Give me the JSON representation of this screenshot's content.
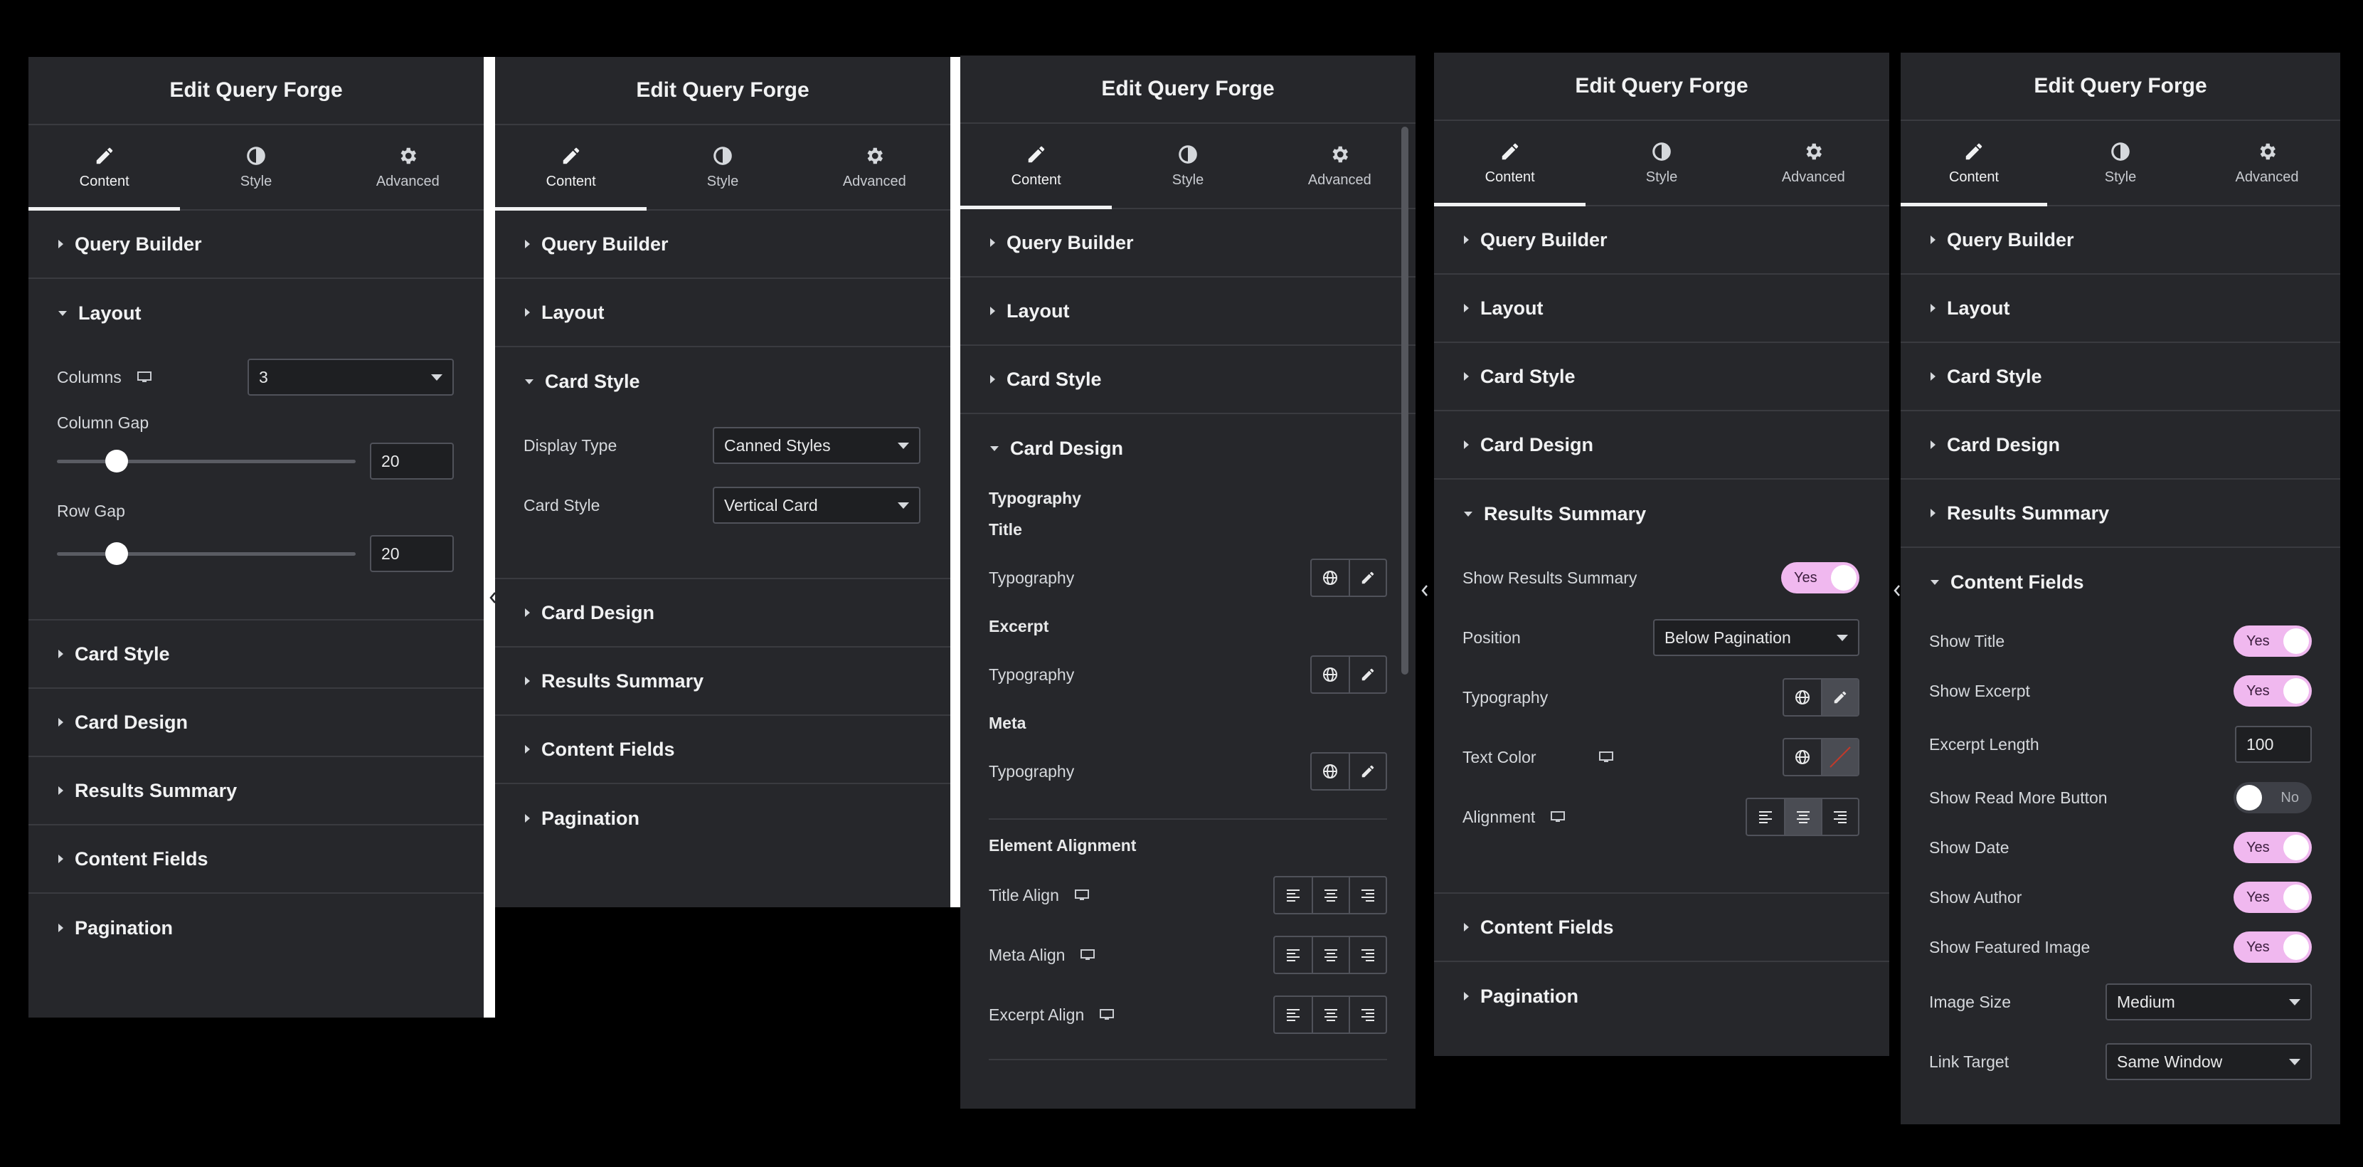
{
  "panel_title": "Edit Query Forge",
  "tabs": {
    "content": "Content",
    "style": "Style",
    "advanced": "Advanced"
  },
  "sections": {
    "query_builder": "Query Builder",
    "layout": "Layout",
    "card_style": "Card Style",
    "card_design": "Card Design",
    "results_summary": "Results Summary",
    "content_fields": "Content Fields",
    "pagination": "Pagination"
  },
  "layout_fields": {
    "columns_label": "Columns",
    "columns_value": "3",
    "column_gap_label": "Column Gap",
    "column_gap_value": "20",
    "column_gap_fraction": 0.2,
    "row_gap_label": "Row Gap",
    "row_gap_value": "20",
    "row_gap_fraction": 0.2
  },
  "card_style_fields": {
    "display_type_label": "Display Type",
    "display_type_value": "Canned Styles",
    "card_style_label": "Card Style",
    "card_style_value": "Vertical Card"
  },
  "card_design_fields": {
    "typography_heading": "Typography",
    "title_heading": "Title",
    "excerpt_heading": "Excerpt",
    "meta_heading": "Meta",
    "typography_label": "Typography",
    "element_alignment_heading": "Element Alignment",
    "title_align_label": "Title Align",
    "meta_align_label": "Meta Align",
    "excerpt_align_label": "Excerpt Align"
  },
  "results_summary_fields": {
    "show_label": "Show Results Summary",
    "show_value": "Yes",
    "position_label": "Position",
    "position_value": "Below Pagination",
    "typography_label": "Typography",
    "text_color_label": "Text Color",
    "alignment_label": "Alignment"
  },
  "content_fields": {
    "show_title_label": "Show Title",
    "show_title_value": "Yes",
    "show_excerpt_label": "Show Excerpt",
    "show_excerpt_value": "Yes",
    "excerpt_length_label": "Excerpt Length",
    "excerpt_length_value": "100",
    "show_read_more_label": "Show Read More Button",
    "show_read_more_value": "No",
    "show_date_label": "Show Date",
    "show_date_value": "Yes",
    "show_author_label": "Show Author",
    "show_author_value": "Yes",
    "show_featured_image_label": "Show Featured Image",
    "show_featured_image_value": "Yes",
    "image_size_label": "Image Size",
    "image_size_value": "Medium",
    "link_target_label": "Link Target",
    "link_target_value": "Same Window"
  },
  "colors": {
    "panel_bg": "#26272b",
    "toggle_on": "#f0b8ef",
    "toggle_off": "#3e4047",
    "text": "#d5d8dc"
  },
  "icons": [
    "pencil-icon",
    "half-circle-icon",
    "gear-icon",
    "desktop-icon",
    "globe-icon",
    "align-left-icon",
    "align-center-icon",
    "align-right-icon",
    "chevron-left-icon"
  ]
}
